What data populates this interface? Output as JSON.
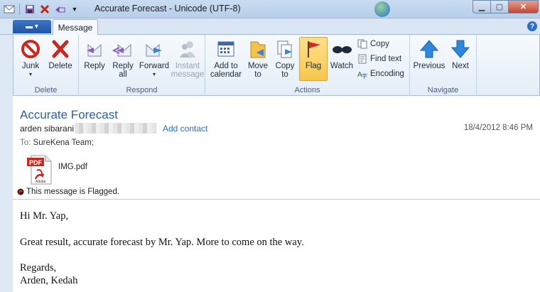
{
  "window": {
    "title": "Accurate Forecast - Unicode (UTF-8)"
  },
  "ribbon": {
    "tab_message": "Message",
    "groups": {
      "delete": "Delete",
      "respond": "Respond",
      "actions": "Actions",
      "navigate": "Navigate"
    },
    "buttons": {
      "junk": "Junk",
      "delete": "Delete",
      "reply": "Reply",
      "reply_all_1": "Reply",
      "reply_all_2": "all",
      "forward": "Forward",
      "instant_1": "Instant",
      "instant_2": "message",
      "add_cal_1": "Add to",
      "add_cal_2": "calendar",
      "move_1": "Move",
      "move_2": "to",
      "copy_1": "Copy",
      "copy_2": "to",
      "flag": "Flag",
      "watch": "Watch",
      "copy_small": "Copy",
      "find_text": "Find text",
      "encoding": "Encoding",
      "previous": "Previous",
      "next": "Next"
    }
  },
  "message": {
    "subject": "Accurate Forecast",
    "sender": "arden sibarani",
    "add_contact": "Add contact",
    "date": "18/4/2012 8:46 PM",
    "to_label": "To:",
    "to": "SureKena Team;",
    "attachment": "IMG.pdf",
    "flag_notice": "This message is Flagged.",
    "body": {
      "greeting": "Hi Mr. Yap,",
      "line1": "Great result, accurate forecast by Mr. Yap. More to come on the way.",
      "closing": "Regards,",
      "signature": "Arden, Kedah"
    }
  },
  "colors": {
    "accent": "#2c5fa0",
    "flag_highlight": "#f8c74a"
  }
}
